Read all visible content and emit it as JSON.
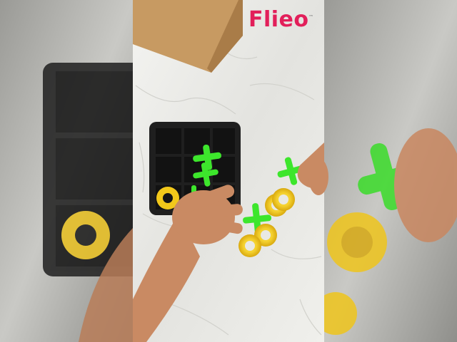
{
  "logo": {
    "text": "Flieo",
    "trademark": "™",
    "color": "#e21f5a"
  },
  "colors": {
    "cloth": "#ecece8",
    "board": "#232323",
    "cross_piece": "#3de62c",
    "ring_piece": "#f2c81a",
    "cardboard": "#c79a62",
    "skin": "#c98a63"
  },
  "scene_objects": [
    "game-board",
    "cross-pieces",
    "ring-pieces",
    "cardboard-box",
    "left-hand",
    "right-hand"
  ]
}
